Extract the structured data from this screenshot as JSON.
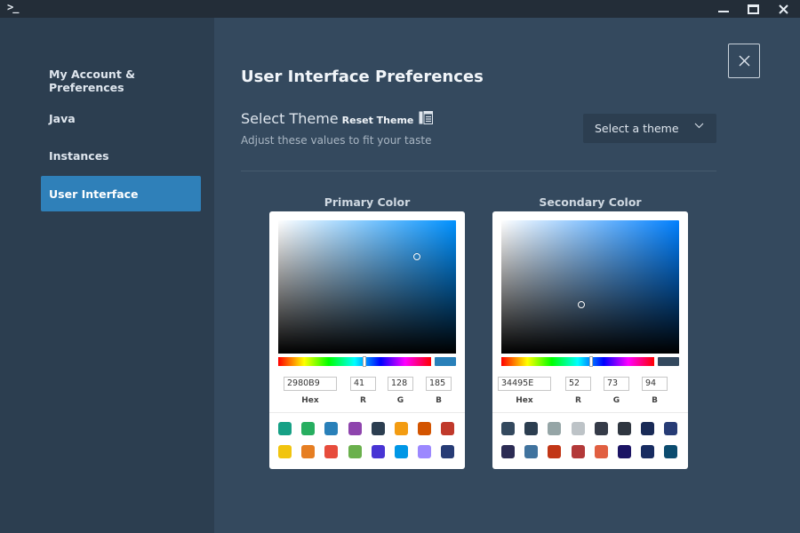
{
  "titlebar": {
    "terminal_glyph": ">_",
    "minimize_icon": "minimize-icon",
    "maximize_icon": "maximize-icon",
    "close_glyph": "✕"
  },
  "sidebar": {
    "items": [
      {
        "label": "My Account & Preferences",
        "active": false
      },
      {
        "label": "Java",
        "active": false
      },
      {
        "label": "Instances",
        "active": false
      },
      {
        "label": "User Interface",
        "active": true
      }
    ],
    "active_color": "#2f80b9"
  },
  "main": {
    "title": "User Interface Preferences",
    "close_icon": "close-icon",
    "theme": {
      "title": "Select Theme",
      "reset_label": "Reset Theme",
      "icon": "layout-icon",
      "subtitle": "Adjust these values to fit your taste",
      "select_value": "Select a theme"
    }
  },
  "primary": {
    "label": "Primary Color",
    "hex": "2980B9",
    "r": "41",
    "g": "128",
    "b": "185",
    "hex_label": "Hex",
    "r_label": "R",
    "g_label": "G",
    "b_label": "B",
    "hue_color": "#0091ff",
    "preview_color": "#2980b9",
    "swatches": [
      "#16a085",
      "#27ae60",
      "#2980b9",
      "#8e44ad",
      "#2c3e50",
      "#f39c12",
      "#d35400",
      "#c0392b",
      "#f1c40f",
      "#e67e22",
      "#e74c3c",
      "#6ab04c",
      "#4834d4",
      "#0097e6",
      "#9c88ff",
      "#273c75"
    ]
  },
  "secondary": {
    "label": "Secondary Color",
    "hex": "34495E",
    "r": "52",
    "g": "73",
    "b": "94",
    "hex_label": "Hex",
    "r_label": "R",
    "g_label": "G",
    "b_label": "B",
    "hue_color": "#0080ff",
    "preview_color": "#34495e",
    "swatches": [
      "#34495e",
      "#2c3e50",
      "#95a5a6",
      "#bdc3c7",
      "#353b48",
      "#2f3640",
      "#192a56",
      "#273c75",
      "#2c2c54",
      "#40739e",
      "#c23616",
      "#b33939",
      "#e15f41",
      "#1b1464",
      "#182c61",
      "#0c4c6f"
    ]
  }
}
